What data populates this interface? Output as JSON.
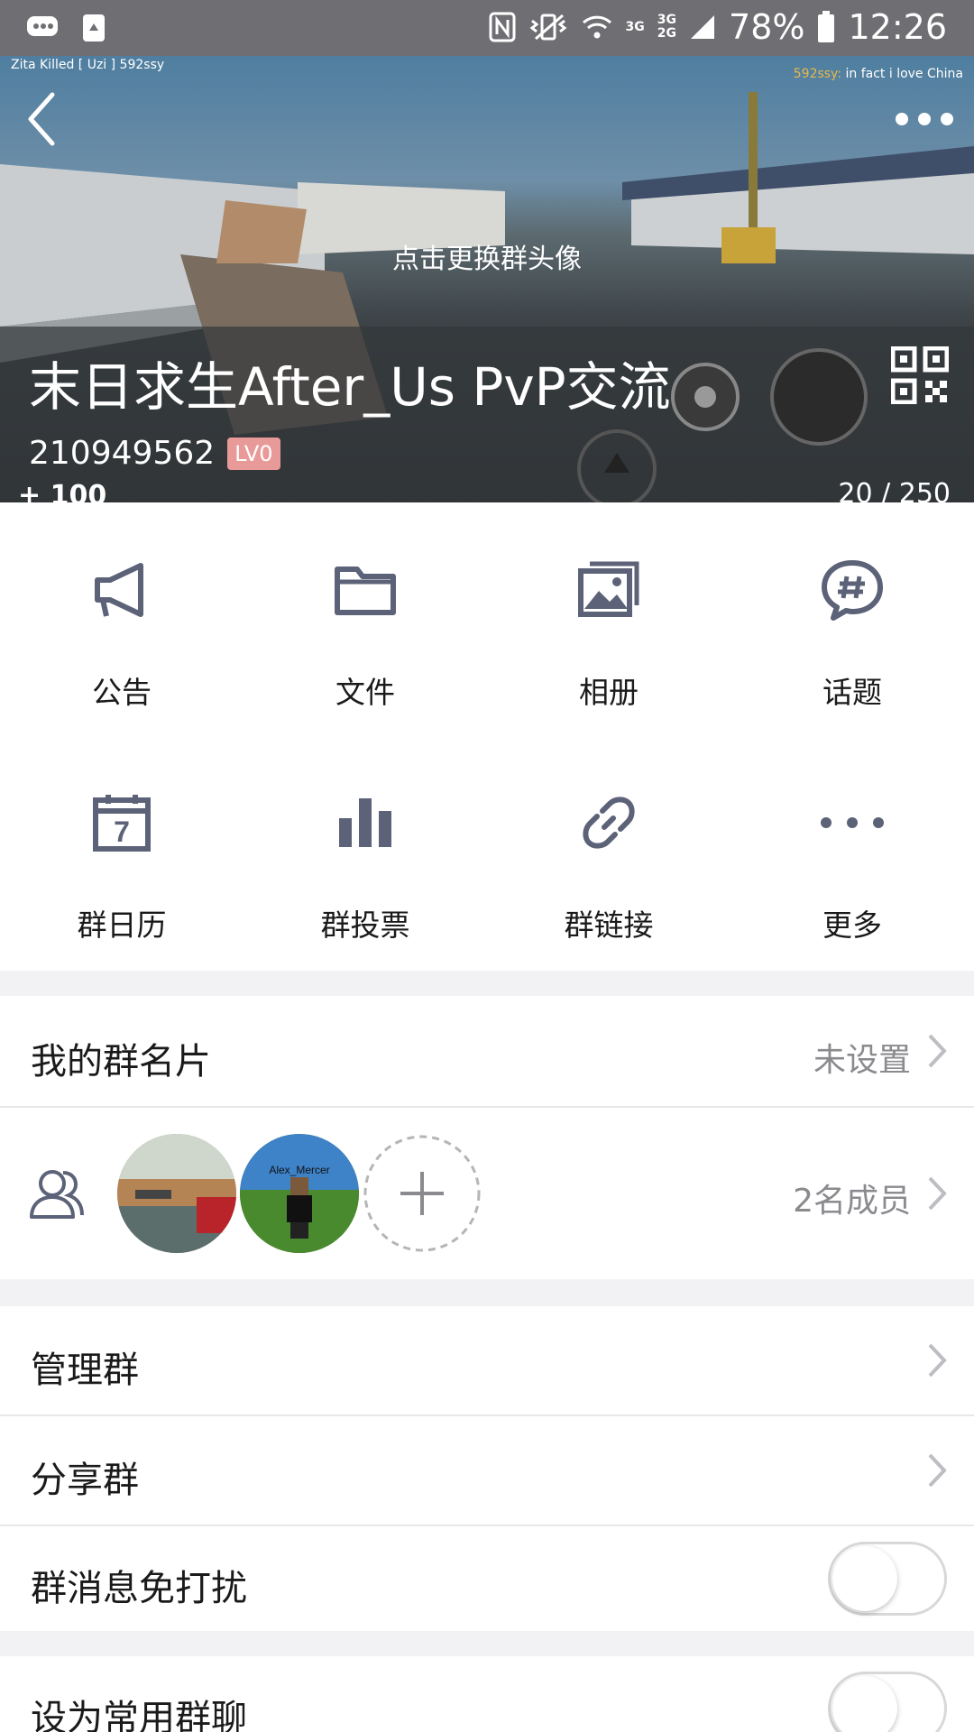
{
  "status_bar": {
    "network_top": "3G",
    "network_mid": "3G",
    "network_bottom": "2G",
    "battery": "78%",
    "time": "12:26"
  },
  "hero": {
    "hud_left": "Zita  Killed [ Uzi ]  592ssy",
    "hud_right_who": "592ssy:",
    "hud_right_msg": " in fact i love China",
    "change_avatar": "点击更换群头像",
    "group_name": "末日求生After_Us PvP交流",
    "group_id": "210949562",
    "level": "LV0",
    "hud_count": "20 / 250",
    "hud_hp": "+ 100"
  },
  "grid": [
    {
      "label": "公告",
      "icon": "megaphone-icon"
    },
    {
      "label": "文件",
      "icon": "folder-icon"
    },
    {
      "label": "相册",
      "icon": "album-icon"
    },
    {
      "label": "话题",
      "icon": "topic-icon"
    },
    {
      "label": "群日历",
      "icon": "calendar-icon",
      "calendar_day": "7"
    },
    {
      "label": "群投票",
      "icon": "poll-icon"
    },
    {
      "label": "群链接",
      "icon": "link-icon"
    },
    {
      "label": "更多",
      "icon": "more-dots-icon"
    }
  ],
  "my_card": {
    "label": "我的群名片",
    "value": "未设置"
  },
  "members": {
    "count_label": "2名成员",
    "avatar_2_text": "Alex_Mercer"
  },
  "manage": {
    "label": "管理群"
  },
  "share": {
    "label": "分享群"
  },
  "dnd": {
    "label": "群消息免打扰",
    "on": false
  },
  "frequent": {
    "label": "设为常用群聊",
    "on": false
  },
  "colors": {
    "icon": "#5c6277",
    "accent_badge": "#e89a98",
    "page_bg": "#f2f2f4"
  }
}
